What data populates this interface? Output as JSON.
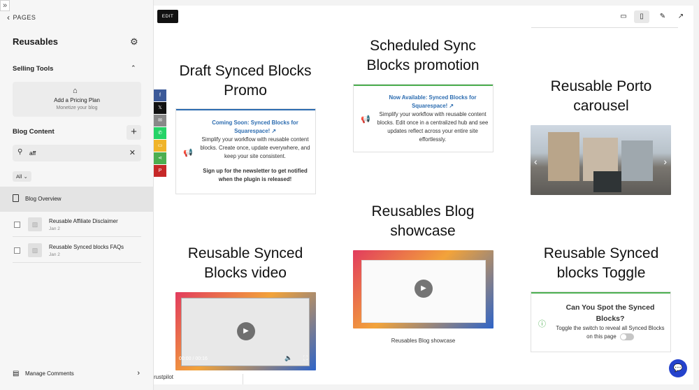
{
  "sidebar": {
    "collapse_icon": "»",
    "back_label": "PAGES",
    "title": "Reusables",
    "selling_tools": "Selling Tools",
    "pricing_card": {
      "title": "Add a Pricing Plan",
      "subtitle": "Monetize your blog"
    },
    "blog_content": "Blog Content",
    "search_value": "aff",
    "filter": "All",
    "overview": "Blog Overview",
    "posts": [
      {
        "title": "Reusable Affiliate Disclaimer",
        "date": "Jan 2"
      },
      {
        "title": "Reusable Synced blocks FAQs",
        "date": "Jan 2"
      }
    ],
    "manage_comments": "Manage Comments"
  },
  "toolbar": {
    "edit": "EDIT"
  },
  "share_colors": [
    "#3b5998",
    "#111111",
    "#888888",
    "#25d366",
    "#f0b429",
    "#4caf50",
    "#c62828"
  ],
  "blocks": {
    "draft": {
      "heading": "Draft Synced Blocks Promo",
      "link": "Coming Soon: Synced Blocks for Squarespace!",
      "text": "Simplify your workflow with reusable content blocks. Create once, update everywhere, and keep your site consistent.",
      "cta": "Sign up for the newsletter to get notified when the plugin is released!"
    },
    "scheduled": {
      "heading": "Scheduled Sync Blocks promotion",
      "link": "Now Available: Synced Blocks for Squarespace!",
      "text": "Simplify your workflow with reusable content blocks. Edit once in a centralized hub and see updates reflect across your entire site effortlessly."
    },
    "porto": {
      "heading": "Reusable Porto carousel"
    },
    "blog_showcase": {
      "heading": "Reusables Blog showcase",
      "caption": "Reusables Blog showcase"
    },
    "video": {
      "heading": "Reusable Synced Blocks video",
      "time": "00:00 / 00:16"
    },
    "toggle": {
      "heading": "Reusable Synced blocks Toggle",
      "title": "Can You Spot the Synced Blocks?",
      "text": "Toggle the switch to reveal all Synced Blocks on this page"
    }
  },
  "footer_fragment": "rustpilot",
  "accent": {
    "blue_bar": "#2c6cb0",
    "green_bar": "#4caf50",
    "link": "#2c6cb0",
    "chat": "#2442cc"
  }
}
